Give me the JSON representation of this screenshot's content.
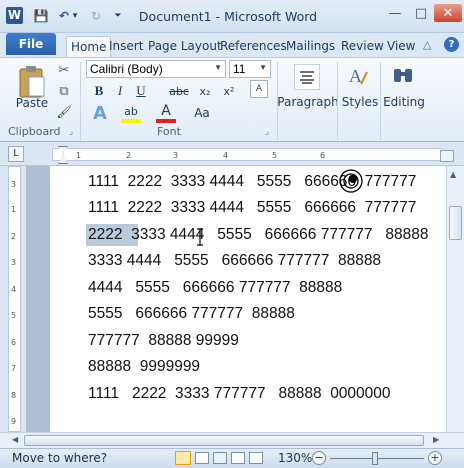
{
  "window": {
    "title": "Document1 - Microsoft Word",
    "app_icon": "W"
  },
  "qat": {
    "save_icon": "💾",
    "undo_icon": "↶",
    "undo_drop": "▾",
    "redo_icon": "↻",
    "customize_icon": "⏷"
  },
  "window_buttons": {
    "minimize": "—",
    "maximize": "□",
    "close": "✕"
  },
  "tabs": [
    "File",
    "Home",
    "Insert",
    "Page Layout",
    "References",
    "Mailings",
    "Review",
    "View"
  ],
  "tab_extras": {
    "minimize_ribbon": "△",
    "help": "?"
  },
  "ribbon": {
    "clipboard": {
      "paste_label": "Paste",
      "cut": "✂",
      "copy": "⧉",
      "format_painter": "🖌",
      "group_label": "Clipboard",
      "launcher": "⌟"
    },
    "font": {
      "font_name": "Calibri (Body)",
      "font_size": "11",
      "grow": "A",
      "shrink": "A",
      "clear": "A",
      "bold": "B",
      "italic": "I",
      "underline": "U",
      "strike": "abc",
      "subscript": "x₂",
      "superscript": "x²",
      "text_effects": "A",
      "highlight": "ab",
      "font_color": "A",
      "change_case": "Aa",
      "group_label": "Font",
      "launcher": "⌟"
    },
    "paragraph_label": "Paragraph",
    "styles_label": "Styles",
    "editing_label": "Editing"
  },
  "ruler": {
    "marks": [
      "1",
      "2",
      "3",
      "4",
      "5",
      "6"
    ],
    "tab_selector": "L"
  },
  "vruler": {
    "marks": [
      "3",
      "1",
      "2",
      "3",
      "4",
      "5",
      "6",
      "7",
      "8",
      "9"
    ]
  },
  "document": {
    "lines": [
      "1111  2222  3333 4444   5555   666666  777777",
      "1111  2222  3333 4444   5555   666666  777777",
      "2222  3333 4444   5555   666666 777777   88888",
      "3333 4444   5555   666666 777777  88888",
      "4444   5555   666666 777777  88888",
      "5555   666666 777777  88888",
      "777777  88888 99999",
      "88888  9999999",
      "1111   2222  3333 777777   88888  0000000"
    ],
    "selected_text": "2222"
  },
  "statusbar": {
    "message": "Move to where?",
    "zoom": "130%",
    "zoom_out": "−",
    "zoom_in": "+"
  }
}
